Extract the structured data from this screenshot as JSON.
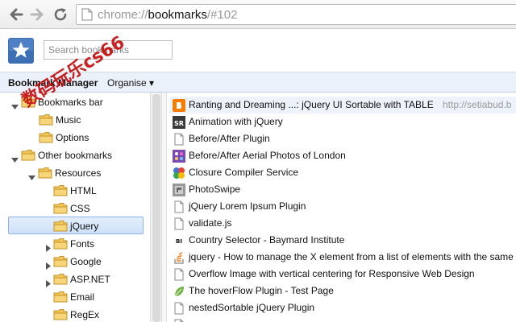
{
  "toolbar": {
    "url_scheme": "chrome://",
    "url_host": "bookmarks",
    "url_path": "/#102"
  },
  "header": {
    "search_placeholder": "Search bookmarks"
  },
  "menubar": {
    "title": "Bookmark Manager",
    "organise": "Organise ▾"
  },
  "tree": [
    {
      "label": "Bookmarks bar",
      "expander": "expanded"
    },
    {
      "label": "Music",
      "expander": "none"
    },
    {
      "label": "Options",
      "expander": "none"
    },
    {
      "label": "Other bookmarks",
      "expander": "expanded"
    },
    {
      "label": "Resources",
      "expander": "expanded"
    },
    {
      "label": "HTML",
      "expander": "none"
    },
    {
      "label": "CSS",
      "expander": "none"
    },
    {
      "label": "jQuery",
      "expander": "none",
      "selected": true
    },
    {
      "label": "Fonts",
      "expander": "collapsed"
    },
    {
      "label": "Google",
      "expander": "collapsed"
    },
    {
      "label": "ASP.NET",
      "expander": "collapsed"
    },
    {
      "label": "Email",
      "expander": "none"
    },
    {
      "label": "RegEx",
      "expander": "none"
    }
  ],
  "bookmarks": [
    {
      "title": "Ranting and Dreaming ...: jQuery UI Sortable with TABLE",
      "url": "http://setiabud.b",
      "icon": "blogger-icon"
    },
    {
      "title": "Animation with jQuery",
      "url": "",
      "icon": "sr-icon"
    },
    {
      "title": "Before/After Plugin",
      "url": "",
      "icon": "page-icon"
    },
    {
      "title": "Before/After Aerial Photos of London",
      "url": "",
      "icon": "purple-dots-icon"
    },
    {
      "title": "Closure Compiler Service",
      "url": "",
      "icon": "google-code-icon"
    },
    {
      "title": "PhotoSwipe",
      "url": "",
      "icon": "photoswipe-icon"
    },
    {
      "title": "jQuery Lorem Ipsum Plugin",
      "url": "",
      "icon": "page-icon"
    },
    {
      "title": "validate.js",
      "url": "",
      "icon": "page-icon"
    },
    {
      "title": "Country Selector - Baymard Institute",
      "url": "",
      "icon": "baymard-icon"
    },
    {
      "title": "jquery - How to manage the X element from a list of elements with the same",
      "url": "",
      "icon": "stackoverflow-icon"
    },
    {
      "title": "Overflow Image with vertical centering for Responsive Web Design",
      "url": "",
      "icon": "page-icon"
    },
    {
      "title": "The hoverFlow Plugin - Test Page",
      "url": "",
      "icon": "green-leaf-icon"
    },
    {
      "title": "nestedSortable jQuery Plugin",
      "url": "",
      "icon": "page-icon"
    },
    {
      "title": "",
      "url": "",
      "icon": "page-icon"
    }
  ],
  "watermark": "数码玩乐cs66",
  "colors": {
    "selection_border": "#8fb2e0",
    "menubar_bg": "#ebf1fa",
    "url_gray": "#999999",
    "watermark_red": "#c40a0a"
  }
}
